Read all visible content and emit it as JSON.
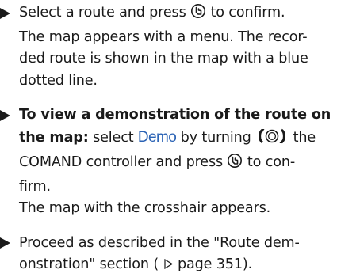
{
  "steps": [
    {
      "lines": [
        {
          "before": "Select a route and press",
          "icon": "press-controller-icon",
          "after": "to confirm."
        },
        {
          "text": "The map appears with a menu. The recor-"
        },
        {
          "text": "ded route is shown in the map with a blue"
        },
        {
          "text": "dotted line."
        }
      ]
    },
    {
      "bold_line1": "To view a demonstration of the route on",
      "bold_line2": "the map:",
      "line2_rest": "select",
      "demo_label": "Demo",
      "line2_after": "by turning",
      "turn_icon": "turn-controller-icon",
      "line2_end": "the",
      "line3_before": "COMAND controller and press",
      "press_icon": "press-controller-icon",
      "line3_after": "to con-",
      "line4": "firm.",
      "line5": "The map with the crosshair appears."
    },
    {
      "line1": "Proceed as described in the \"Route dem-",
      "line2_before": "onstration\" section (",
      "ref_icon": "page-reference-triangle-icon",
      "line2_after": "page 351)."
    }
  ],
  "bullet_icon": "right-triangle-bullet-icon",
  "colors": {
    "text": "#1a1a1a",
    "demo_highlight": "#2b63b5"
  }
}
